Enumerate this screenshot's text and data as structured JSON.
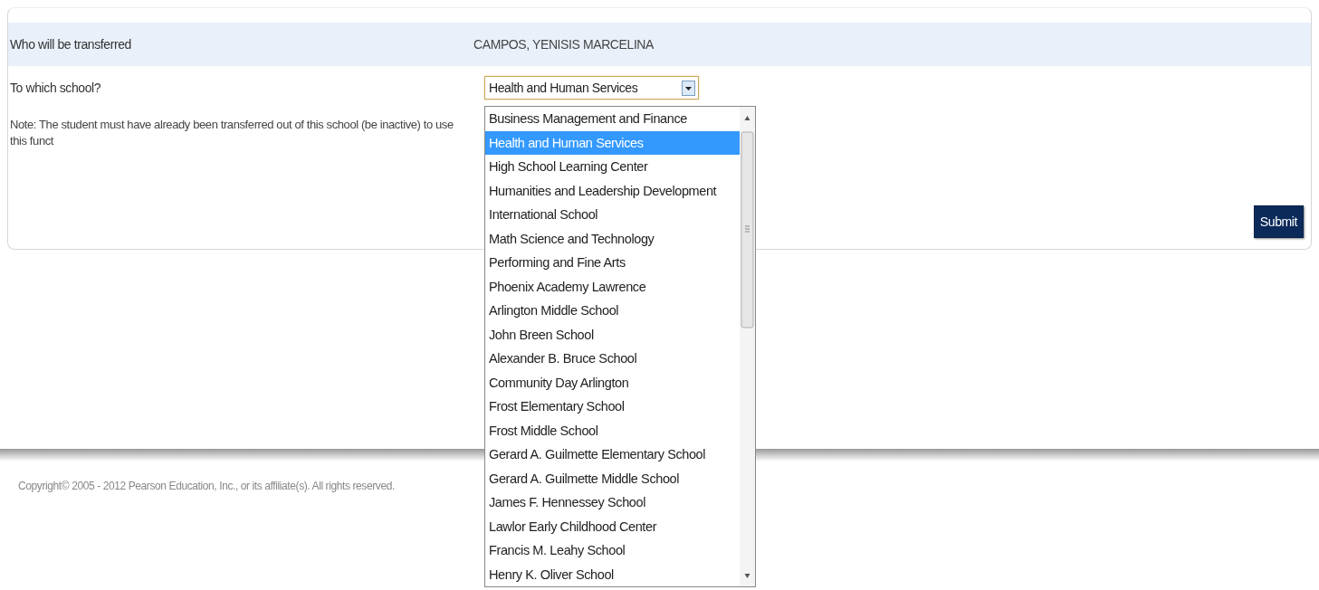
{
  "rows": [
    {
      "label": "Who will be transferred",
      "value": "CAMPOS, YENISIS MARCELINA"
    }
  ],
  "school_select": {
    "label": "To which school?",
    "value": "Health and Human Services",
    "expanded": true,
    "options": [
      {
        "label": "Business Management and Finance",
        "selected": false
      },
      {
        "label": "Health and Human Services",
        "selected": true
      },
      {
        "label": "High School Learning Center",
        "selected": false
      },
      {
        "label": "Humanities and Leadership Development",
        "selected": false
      },
      {
        "label": "International School",
        "selected": false
      },
      {
        "label": "Math Science and Technology",
        "selected": false
      },
      {
        "label": "Performing and Fine Arts",
        "selected": false
      },
      {
        "label": "Phoenix Academy Lawrence",
        "selected": false
      },
      {
        "label": "Arlington Middle School",
        "selected": false
      },
      {
        "label": "John Breen School",
        "selected": false
      },
      {
        "label": "Alexander B. Bruce School",
        "selected": false
      },
      {
        "label": "Community Day Arlington",
        "selected": false
      },
      {
        "label": "Frost Elementary School",
        "selected": false
      },
      {
        "label": "Frost Middle School",
        "selected": false
      },
      {
        "label": "Gerard A. Guilmette Elementary School",
        "selected": false
      },
      {
        "label": "Gerard A. Guilmette Middle School",
        "selected": false
      },
      {
        "label": "James F. Hennessey School",
        "selected": false
      },
      {
        "label": "Lawlor Early Childhood Center",
        "selected": false
      },
      {
        "label": "Francis M. Leahy School",
        "selected": false
      },
      {
        "label": "Henry K. Oliver School",
        "selected": false
      }
    ]
  },
  "note": "Note: The student must have already been transferred out of this school (be inactive) to use this funct",
  "submit_button": "Submit",
  "footer": {
    "copyright": "Copyright© 2005 - 2012 Pearson Education, Inc., or its affiliate(s). All rights reserved."
  }
}
